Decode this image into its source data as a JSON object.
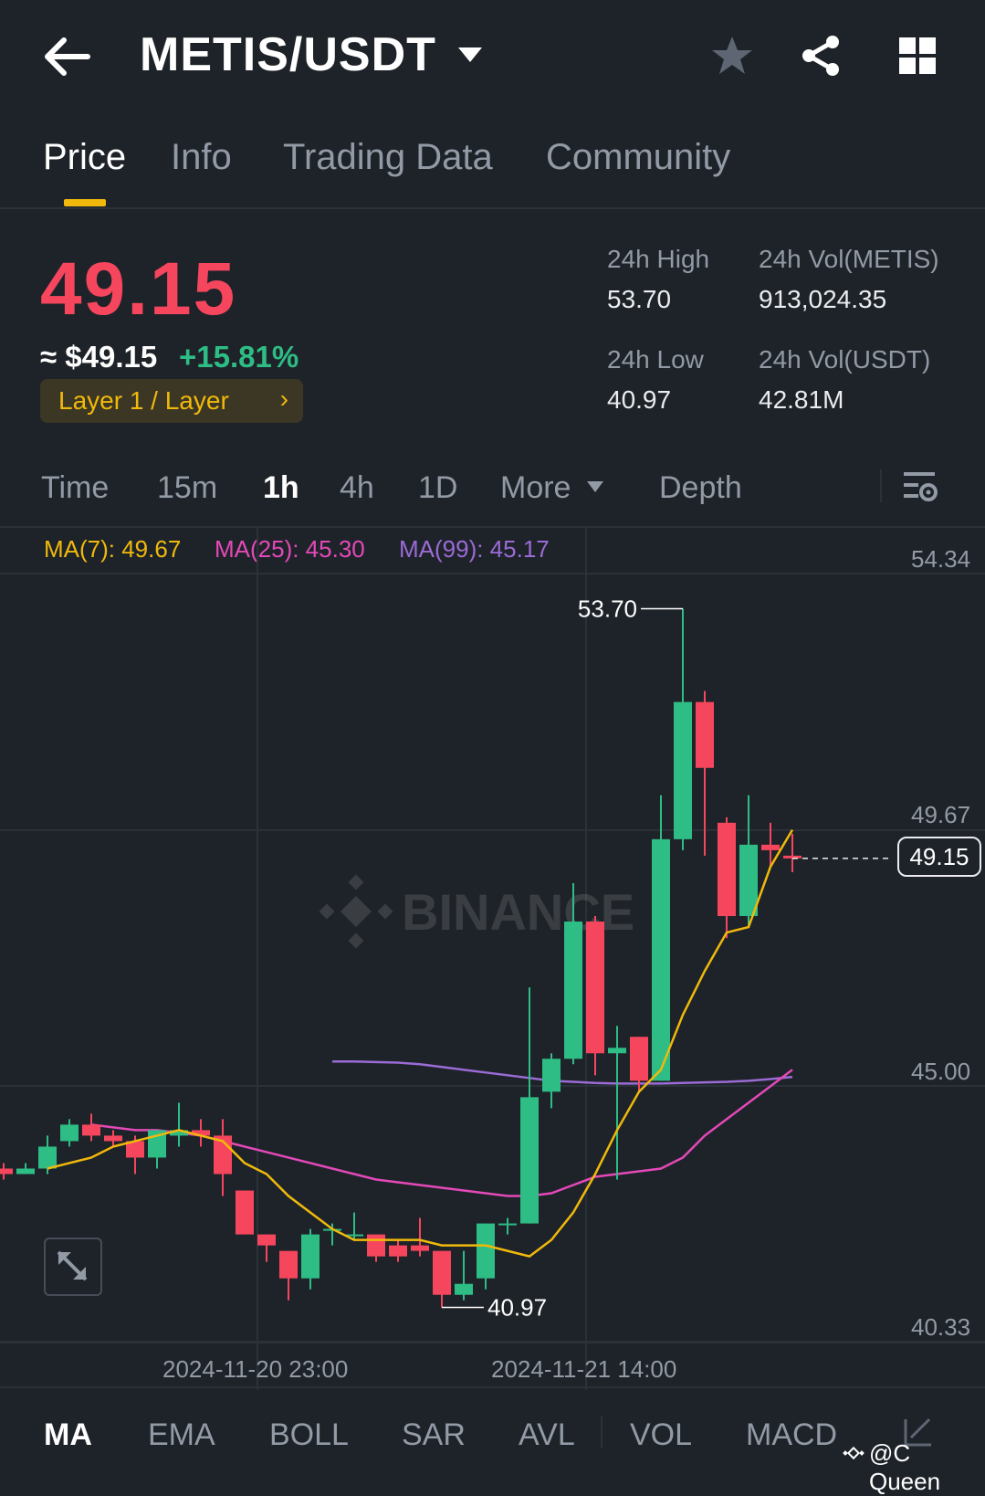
{
  "header": {
    "back_icon": "arrow-left-icon",
    "pair": "METIS/USDT",
    "icons": [
      "star-icon",
      "share-icon",
      "grid-icon"
    ]
  },
  "tabs": [
    {
      "label": "Price",
      "active": true
    },
    {
      "label": "Info",
      "active": false
    },
    {
      "label": "Trading Data",
      "active": false
    },
    {
      "label": "Community",
      "active": false
    }
  ],
  "price": {
    "last": "49.15",
    "usd": "≈ $49.15",
    "change": "+15.81%",
    "tag": "Layer 1 / Layer"
  },
  "stats": {
    "high_label": "24h High",
    "high_value": "53.70",
    "low_label": "24h Low",
    "low_value": "40.97",
    "vol_base_label": "24h Vol(METIS)",
    "vol_base_value": "913,024.35",
    "vol_quote_label": "24h Vol(USDT)",
    "vol_quote_value": "42.81M"
  },
  "intervals": [
    {
      "label": "Time",
      "active": false
    },
    {
      "label": "15m",
      "active": false
    },
    {
      "label": "1h",
      "active": true
    },
    {
      "label": "4h",
      "active": false
    },
    {
      "label": "1D",
      "active": false
    },
    {
      "label": "More",
      "active": false
    },
    {
      "label": "Depth",
      "active": false
    }
  ],
  "ma": {
    "ma7": "MA(7): 49.67",
    "ma25": "MA(25): 45.30",
    "ma99": "MA(99): 45.17"
  },
  "colors": {
    "up": "#2ebd85",
    "down": "#f6465d",
    "accent": "#f0b90b",
    "ma7": "#f0b90b",
    "ma25": "#e349b8",
    "ma99": "#9b6bd6"
  },
  "chart_data": {
    "type": "candlestick",
    "interval": "1h",
    "y_ticks": [
      "54.34",
      "49.67",
      "45.00",
      "40.33"
    ],
    "ylim": [
      40.33,
      54.34
    ],
    "x_ticks": [
      "2024-11-20 23:00",
      "2024-11-21 14:00"
    ],
    "high_annotation": "53.70",
    "low_annotation": "40.97",
    "last_price": "49.15",
    "candles": [
      {
        "o": 43.5,
        "h": 43.6,
        "l": 43.3,
        "c": 43.4
      },
      {
        "o": 43.4,
        "h": 43.6,
        "l": 43.4,
        "c": 43.5
      },
      {
        "o": 43.5,
        "h": 44.1,
        "l": 43.4,
        "c": 43.9
      },
      {
        "o": 44.0,
        "h": 44.4,
        "l": 43.9,
        "c": 44.3
      },
      {
        "o": 44.3,
        "h": 44.5,
        "l": 44.0,
        "c": 44.1
      },
      {
        "o": 44.1,
        "h": 44.2,
        "l": 43.9,
        "c": 44.0
      },
      {
        "o": 44.0,
        "h": 44.1,
        "l": 43.4,
        "c": 43.7
      },
      {
        "o": 43.7,
        "h": 44.2,
        "l": 43.5,
        "c": 44.2
      },
      {
        "o": 44.1,
        "h": 44.7,
        "l": 43.9,
        "c": 44.2
      },
      {
        "o": 44.2,
        "h": 44.4,
        "l": 43.9,
        "c": 44.1
      },
      {
        "o": 44.1,
        "h": 44.4,
        "l": 43.0,
        "c": 43.4
      },
      {
        "o": 43.1,
        "h": 43.1,
        "l": 42.3,
        "c": 42.3
      },
      {
        "o": 42.3,
        "h": 42.3,
        "l": 41.8,
        "c": 42.1
      },
      {
        "o": 42.0,
        "h": 42.0,
        "l": 41.1,
        "c": 41.5
      },
      {
        "o": 41.5,
        "h": 42.4,
        "l": 41.3,
        "c": 42.3
      },
      {
        "o": 42.4,
        "h": 42.5,
        "l": 42.1,
        "c": 42.4
      },
      {
        "o": 42.3,
        "h": 42.7,
        "l": 42.2,
        "c": 42.3
      },
      {
        "o": 42.3,
        "h": 42.3,
        "l": 41.8,
        "c": 41.9
      },
      {
        "o": 42.1,
        "h": 42.2,
        "l": 41.8,
        "c": 41.9
      },
      {
        "o": 42.1,
        "h": 42.6,
        "l": 41.9,
        "c": 42.0
      },
      {
        "o": 42.0,
        "h": 42.0,
        "l": 40.97,
        "c": 41.2
      },
      {
        "o": 41.2,
        "h": 42.0,
        "l": 41.1,
        "c": 41.4
      },
      {
        "o": 41.5,
        "h": 42.5,
        "l": 41.3,
        "c": 42.5
      },
      {
        "o": 42.5,
        "h": 42.6,
        "l": 42.3,
        "c": 42.5
      },
      {
        "o": 42.5,
        "h": 46.8,
        "l": 42.5,
        "c": 44.8
      },
      {
        "o": 44.9,
        "h": 45.6,
        "l": 44.6,
        "c": 45.5
      },
      {
        "o": 45.5,
        "h": 48.7,
        "l": 45.4,
        "c": 48.0
      },
      {
        "o": 48.0,
        "h": 48.1,
        "l": 45.2,
        "c": 45.6
      },
      {
        "o": 45.6,
        "h": 46.1,
        "l": 43.3,
        "c": 45.7
      },
      {
        "o": 45.9,
        "h": 45.9,
        "l": 44.9,
        "c": 45.1
      },
      {
        "o": 45.1,
        "h": 50.3,
        "l": 45.1,
        "c": 49.5
      },
      {
        "o": 49.5,
        "h": 53.7,
        "l": 49.3,
        "c": 52.0
      },
      {
        "o": 52.0,
        "h": 52.2,
        "l": 49.2,
        "c": 50.8
      },
      {
        "o": 49.8,
        "h": 49.9,
        "l": 47.7,
        "c": 48.1
      },
      {
        "o": 48.1,
        "h": 50.3,
        "l": 47.9,
        "c": 49.4
      },
      {
        "o": 49.4,
        "h": 49.8,
        "l": 49.0,
        "c": 49.3
      },
      {
        "o": 49.2,
        "h": 49.6,
        "l": 48.9,
        "c": 49.15
      }
    ],
    "ma7_series": [
      43.5,
      43.6,
      43.7,
      43.9,
      44.0,
      44.1,
      44.2,
      44.1,
      44.0,
      43.6,
      43.4,
      43.0,
      42.7,
      42.4,
      42.2,
      42.2,
      42.2,
      42.2,
      42.1,
      42.1,
      42.1,
      42.0,
      41.9,
      42.2,
      42.7,
      43.4,
      44.2,
      44.9,
      45.3,
      46.3,
      47.1,
      47.8,
      47.9,
      49.0,
      49.67
    ],
    "ma25_series": [
      44.3,
      44.25,
      44.2,
      44.2,
      44.15,
      44.1,
      44.0,
      43.9,
      43.8,
      43.7,
      43.6,
      43.5,
      43.4,
      43.3,
      43.25,
      43.2,
      43.15,
      43.1,
      43.05,
      43.0,
      43.0,
      43.05,
      43.2,
      43.35,
      43.4,
      43.45,
      43.5,
      43.7,
      44.1,
      44.4,
      44.7,
      45.0,
      45.3
    ],
    "ma99_series": [
      45.45,
      45.45,
      45.44,
      45.43,
      45.4,
      45.35,
      45.3,
      45.25,
      45.2,
      45.15,
      45.1,
      45.08,
      45.06,
      45.05,
      45.05,
      45.05,
      45.06,
      45.07,
      45.08,
      45.1,
      45.13,
      45.17
    ]
  },
  "indicators": [
    {
      "label": "MA",
      "active": true
    },
    {
      "label": "EMA",
      "active": false
    },
    {
      "label": "BOLL",
      "active": false
    },
    {
      "label": "SAR",
      "active": false
    },
    {
      "label": "AVL",
      "active": false
    },
    {
      "label": "VOL",
      "active": false
    },
    {
      "label": "MACD",
      "active": false
    }
  ],
  "watermark": "BINANCE",
  "user_tag": "@C Queen"
}
